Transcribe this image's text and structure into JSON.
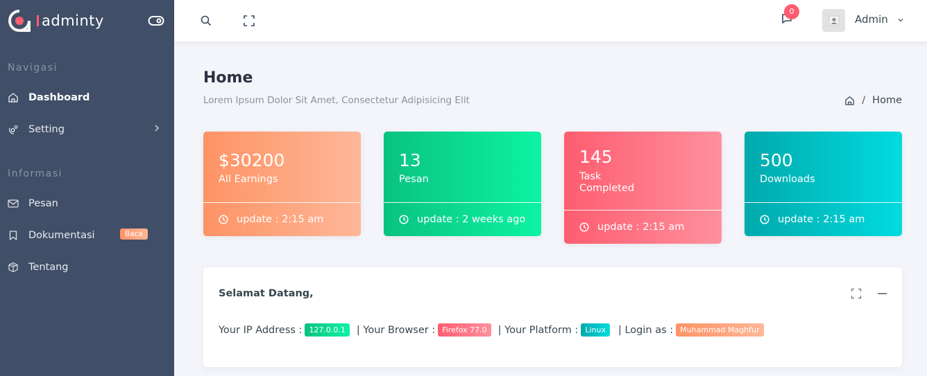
{
  "brand": {
    "name": "adminty"
  },
  "sidebar": {
    "sections": [
      {
        "caption": "Navigasi",
        "items": [
          {
            "label": "Dashboard",
            "icon": "home-icon",
            "active": true
          },
          {
            "label": "Setting",
            "icon": "settings-icon",
            "has_submenu": true
          }
        ]
      },
      {
        "caption": "Informasi",
        "items": [
          {
            "label": "Pesan",
            "icon": "mail-icon"
          },
          {
            "label": "Dokumentasi",
            "icon": "bookmark-icon",
            "badge": "Baca"
          },
          {
            "label": "Tentang",
            "icon": "box-icon"
          }
        ]
      }
    ]
  },
  "header": {
    "notification_count": "0",
    "user_name": "Admin"
  },
  "page": {
    "title": "Home",
    "subtitle": "Lorem Ipsum Dolor Sit Amet, Consectetur Adipisicing Elit",
    "breadcrumb": [
      "Home"
    ]
  },
  "cards": [
    {
      "value": "$30200",
      "label": "All Earnings",
      "update": "update : 2:15 am",
      "color": "#fe9365"
    },
    {
      "value": "13",
      "label": "Pesan",
      "update": "update : 2 weeks ago",
      "color": "#0ac282"
    },
    {
      "value": "145",
      "label_line1": "Task",
      "label_line2": "Completed",
      "update": "update : 2:15 am",
      "color": "#fe5d70"
    },
    {
      "value": "500",
      "label": "Downloads",
      "update": "update : 2:15 am",
      "color": "#01a9ac"
    }
  ],
  "welcome": {
    "title": "Selamat Datang,",
    "ip_label": "Your IP Address :",
    "ip_value": "127.0.0.1",
    "browser_label": "| Your Browser :",
    "browser_value": "Firefox 77.0",
    "platform_label": "| Your Platform :",
    "platform_value": "Linux",
    "login_label": "| Login as :",
    "login_value": "Muhammad Maghfur"
  }
}
